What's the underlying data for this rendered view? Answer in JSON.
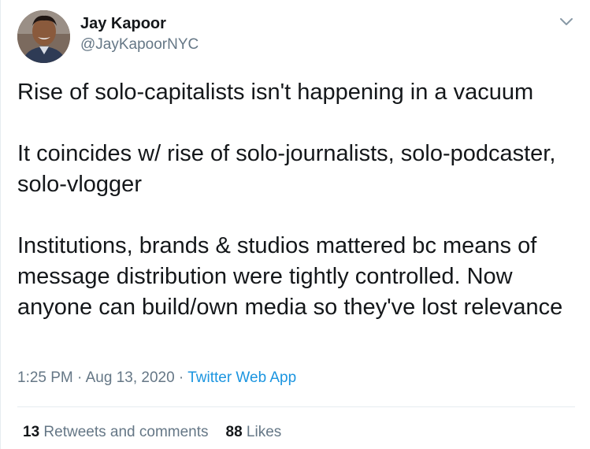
{
  "author": {
    "name": "Jay Kapoor",
    "handle": "@JayKapoorNYC",
    "avatar_icon": "profile-photo"
  },
  "menu": {
    "icon": "chevron-down-icon"
  },
  "tweet": {
    "paragraphs": [
      "Rise of solo-capitalists isn't happening in a vacuum",
      "It coincides w/ rise of solo-journalists, solo-podcaster, solo-vlogger",
      "Institutions, brands & studios mattered bc means of message distribution were tightly controlled. Now anyone can build/own media so they've lost relevance"
    ]
  },
  "meta": {
    "time": "1:25 PM",
    "separator": " · ",
    "date": "Aug 13, 2020",
    "source": "Twitter Web App"
  },
  "stats": {
    "retweets_count": "13",
    "retweets_label": " Retweets and comments",
    "likes_count": "88",
    "likes_label": " Likes"
  },
  "colors": {
    "text": "#14171a",
    "secondary": "#657786",
    "link": "#1b95e0",
    "divider": "#e6ecf0"
  }
}
